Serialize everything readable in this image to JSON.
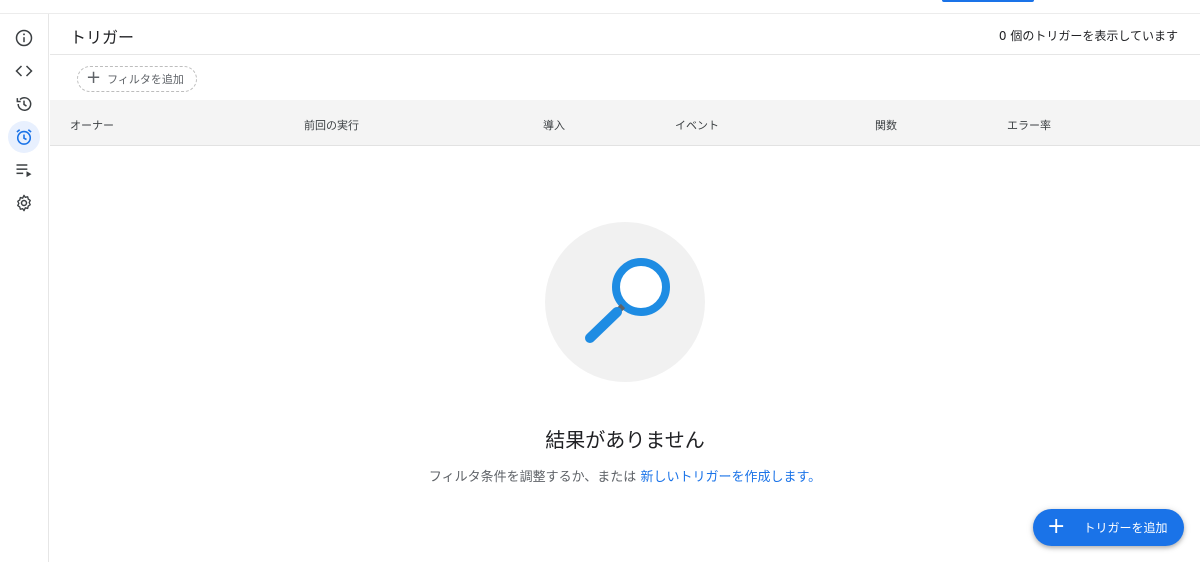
{
  "header": {
    "title": "トリガー",
    "count_text": "0 個のトリガーを表示しています"
  },
  "filter": {
    "add_label": "フィルタを追加"
  },
  "table": {
    "columns": [
      "オーナー",
      "前回の実行",
      "導入",
      "イベント",
      "関数",
      "エラー率"
    ]
  },
  "empty_state": {
    "title": "結果がありません",
    "subtitle_prefix": "フィルタ条件を調整するか、または ",
    "subtitle_link": "新しいトリガーを作成します。"
  },
  "fab": {
    "label": "トリガーを追加"
  },
  "sidebar": {
    "items": [
      {
        "icon": "info-icon",
        "active": false
      },
      {
        "icon": "code-icon",
        "active": false
      },
      {
        "icon": "history-icon",
        "active": false
      },
      {
        "icon": "alarm-clock-icon",
        "active": true
      },
      {
        "icon": "executions-icon",
        "active": false
      },
      {
        "icon": "gear-icon",
        "active": false
      }
    ]
  },
  "colors": {
    "accent": "#1a73e8",
    "active_nav_bg": "#e8f0fe",
    "table_header_bg": "#f4f4f4",
    "magnifier_blue": "#1e8ce3"
  }
}
